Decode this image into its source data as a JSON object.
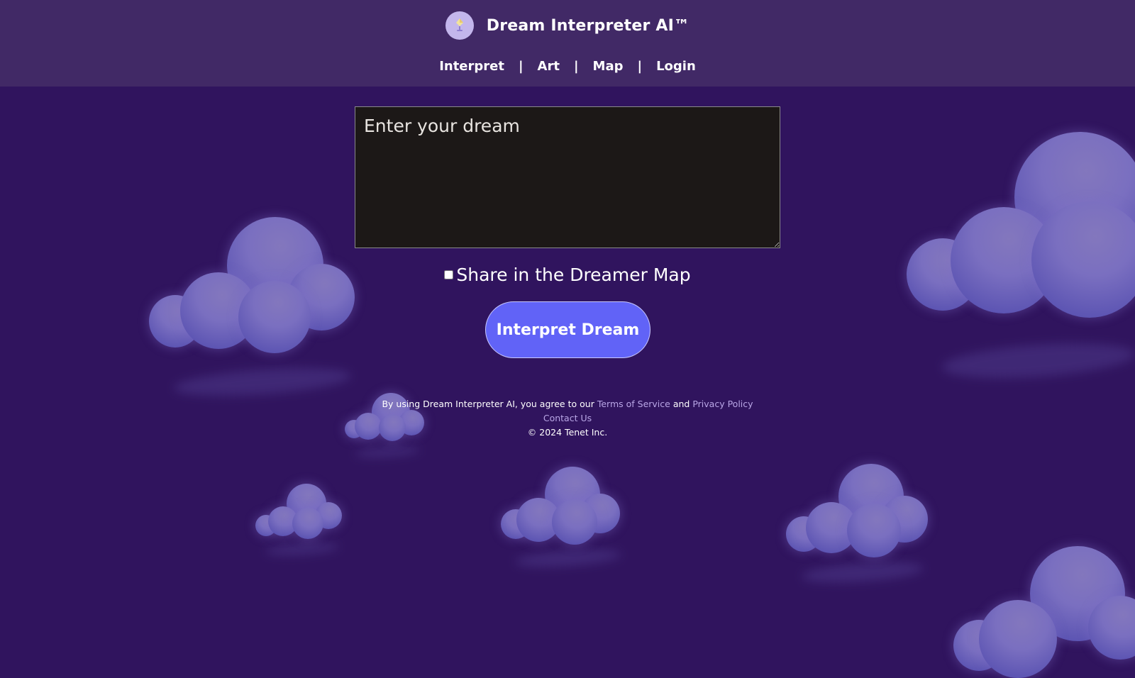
{
  "header": {
    "brand_title": "Dream Interpreter AI™",
    "logo_icon": "lamp-icon",
    "nav": [
      {
        "label": "Interpret"
      },
      {
        "label": "Art"
      },
      {
        "label": "Map"
      },
      {
        "label": "Login"
      }
    ],
    "nav_separator": "|"
  },
  "form": {
    "dream_placeholder": "Enter your dream",
    "dream_value": "",
    "share_label": "Share in the Dreamer Map",
    "share_checked": false,
    "submit_label": "Interpret Dream"
  },
  "footer": {
    "agree_prefix": "By using Dream Interpreter AI, you agree to our",
    "terms_label": "Terms of Service",
    "and_text": "and",
    "privacy_label": "Privacy Policy",
    "contact_label": "Contact Us",
    "copyright": "© 2024 Tenet Inc."
  },
  "colors": {
    "background": "#30145e",
    "header_background": "#412966",
    "accent_button": "#6163f7",
    "link": "#b9a6e6",
    "textarea_background": "#1c1817",
    "cloud": "#7a6fc0"
  }
}
